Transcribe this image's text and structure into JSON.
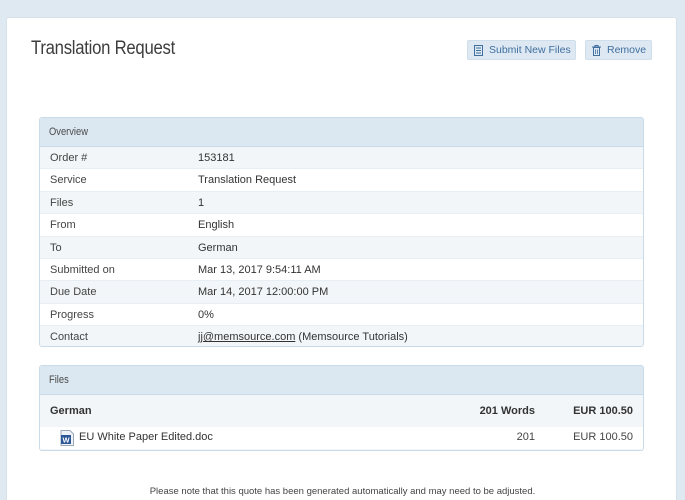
{
  "page": {
    "title": "Translation Request"
  },
  "actions": {
    "submit_label": "Submit New Files",
    "submit_icon": "document-icon",
    "remove_label": "Remove",
    "remove_icon": "trash-icon"
  },
  "overview": {
    "heading": "Overview",
    "rows": [
      {
        "label": "Order #",
        "value": "153181"
      },
      {
        "label": "Service",
        "value": "Translation Request"
      },
      {
        "label": "Files",
        "value": "1"
      },
      {
        "label": "From",
        "value": "English"
      },
      {
        "label": "To",
        "value": "German"
      },
      {
        "label": "Submitted on",
        "value": "Mar 13, 2017 9:54:11 AM"
      },
      {
        "label": "Due Date",
        "value": "Mar 14, 2017 12:00:00 PM"
      },
      {
        "label": "Progress",
        "value": "0%"
      }
    ],
    "contact": {
      "label": "Contact",
      "email": "jj@memsource.com",
      "name": "(Memsource Tutorials)"
    }
  },
  "files": {
    "heading": "Files",
    "language": "German",
    "total_words": "201 Words",
    "total_price": "EUR 100.50",
    "items": [
      {
        "name": "EU White Paper Edited.doc",
        "words": "201",
        "price": "EUR 100.50",
        "icon": "word-doc-icon"
      }
    ]
  },
  "footer": {
    "note": "Please note that this quote has been generated automatically and may need to be adjusted."
  },
  "colors": {
    "background": "#dfe9f2",
    "panel_header": "#dce8f1",
    "button_bg": "#dde8f2",
    "button_text": "#3f6f9e",
    "word_icon": "#2b5797"
  }
}
